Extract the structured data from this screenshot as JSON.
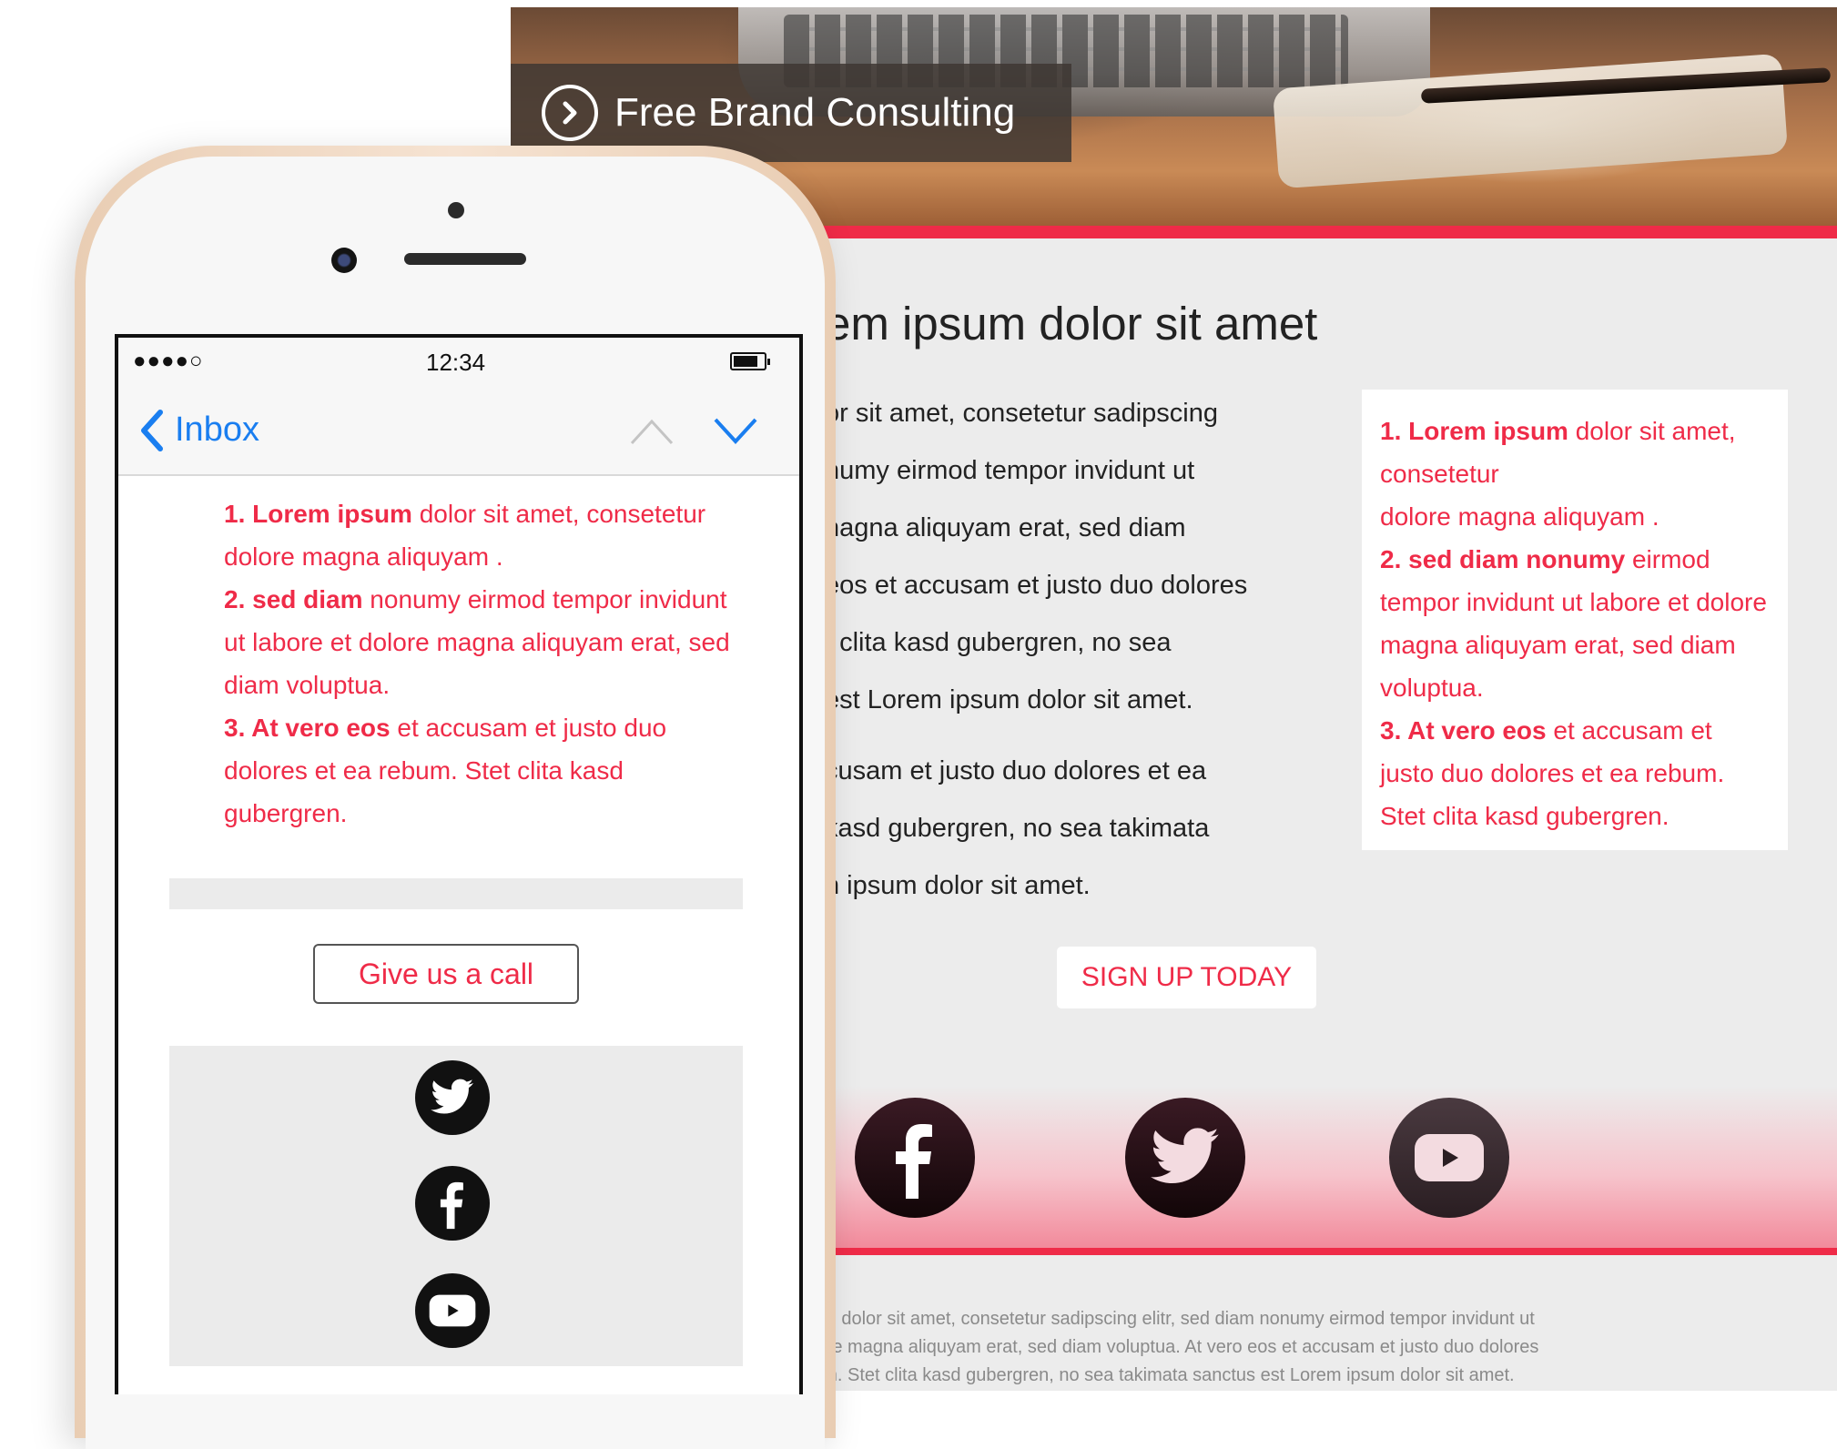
{
  "desktop": {
    "banner_label": "Free Brand Consulting",
    "heading": "em ipsum dolor sit amet",
    "body_lines": [
      "or sit amet, consetetur sadipscing",
      "numy eirmod tempor invidunt ut",
      "nagna aliquyam erat, sed diam",
      "eos et accusam et justo duo dolores",
      ": clita kasd gubergren, no sea",
      " est Lorem ipsum dolor sit amet.",
      "cusam et justo duo dolores et ea",
      "kasd gubergren, no sea takimata",
      "n ipsum dolor sit amet."
    ],
    "sidebar": {
      "item1_bold": "1. Lorem ipsum",
      "item1_text": " dolor sit amet, consetetur",
      "item1_text2": "dolore magna aliquyam .",
      "item2_bold": "2. sed diam nonumy",
      "item2_text": " eirmod tempor invidunt ut labore et dolore magna aliquyam erat, sed diam voluptua.",
      "item3_bold": "3. At vero eos",
      "item3_text": " et accusam et justo duo dolores et ea rebum. Stet clita kasd gubergren."
    },
    "signup_label": "SIGN UP TODAY",
    "social_icons": [
      "facebook-icon",
      "twitter-icon",
      "youtube-icon"
    ],
    "footer_lines": [
      "sum dolor sit amet, consetetur sadipscing elitr, sed diam nonumy eirmod tempor invidunt ut",
      "olore magna aliquyam erat, sed diam voluptua. At vero eos et accusam et justo duo dolores",
      "bum. Stet clita kasd gubergren, no sea takimata sanctus est Lorem ipsum dolor sit amet."
    ],
    "accent_color": "#ef2b48"
  },
  "phone": {
    "status": {
      "signal": "●●●●○",
      "time": "12:34"
    },
    "nav": {
      "back_label": "Inbox"
    },
    "list": {
      "item1_bold": "1. Lorem ipsum",
      "item1_text": " dolor sit amet, consetetur dolore magna aliquyam .",
      "item2_bold": "2. sed diam",
      "item2_text": " nonumy eirmod tempor invidunt ut labore et dolore magna aliquyam erat, sed diam voluptua.",
      "item3_bold": "3. At vero eos",
      "item3_text": " et accusam et justo duo dolores et ea rebum. Stet clita kasd gubergren."
    },
    "call_label": "Give us a call",
    "social_icons": [
      "twitter-icon",
      "facebook-icon",
      "youtube-icon"
    ],
    "nav_color": "#1a7ef0"
  }
}
